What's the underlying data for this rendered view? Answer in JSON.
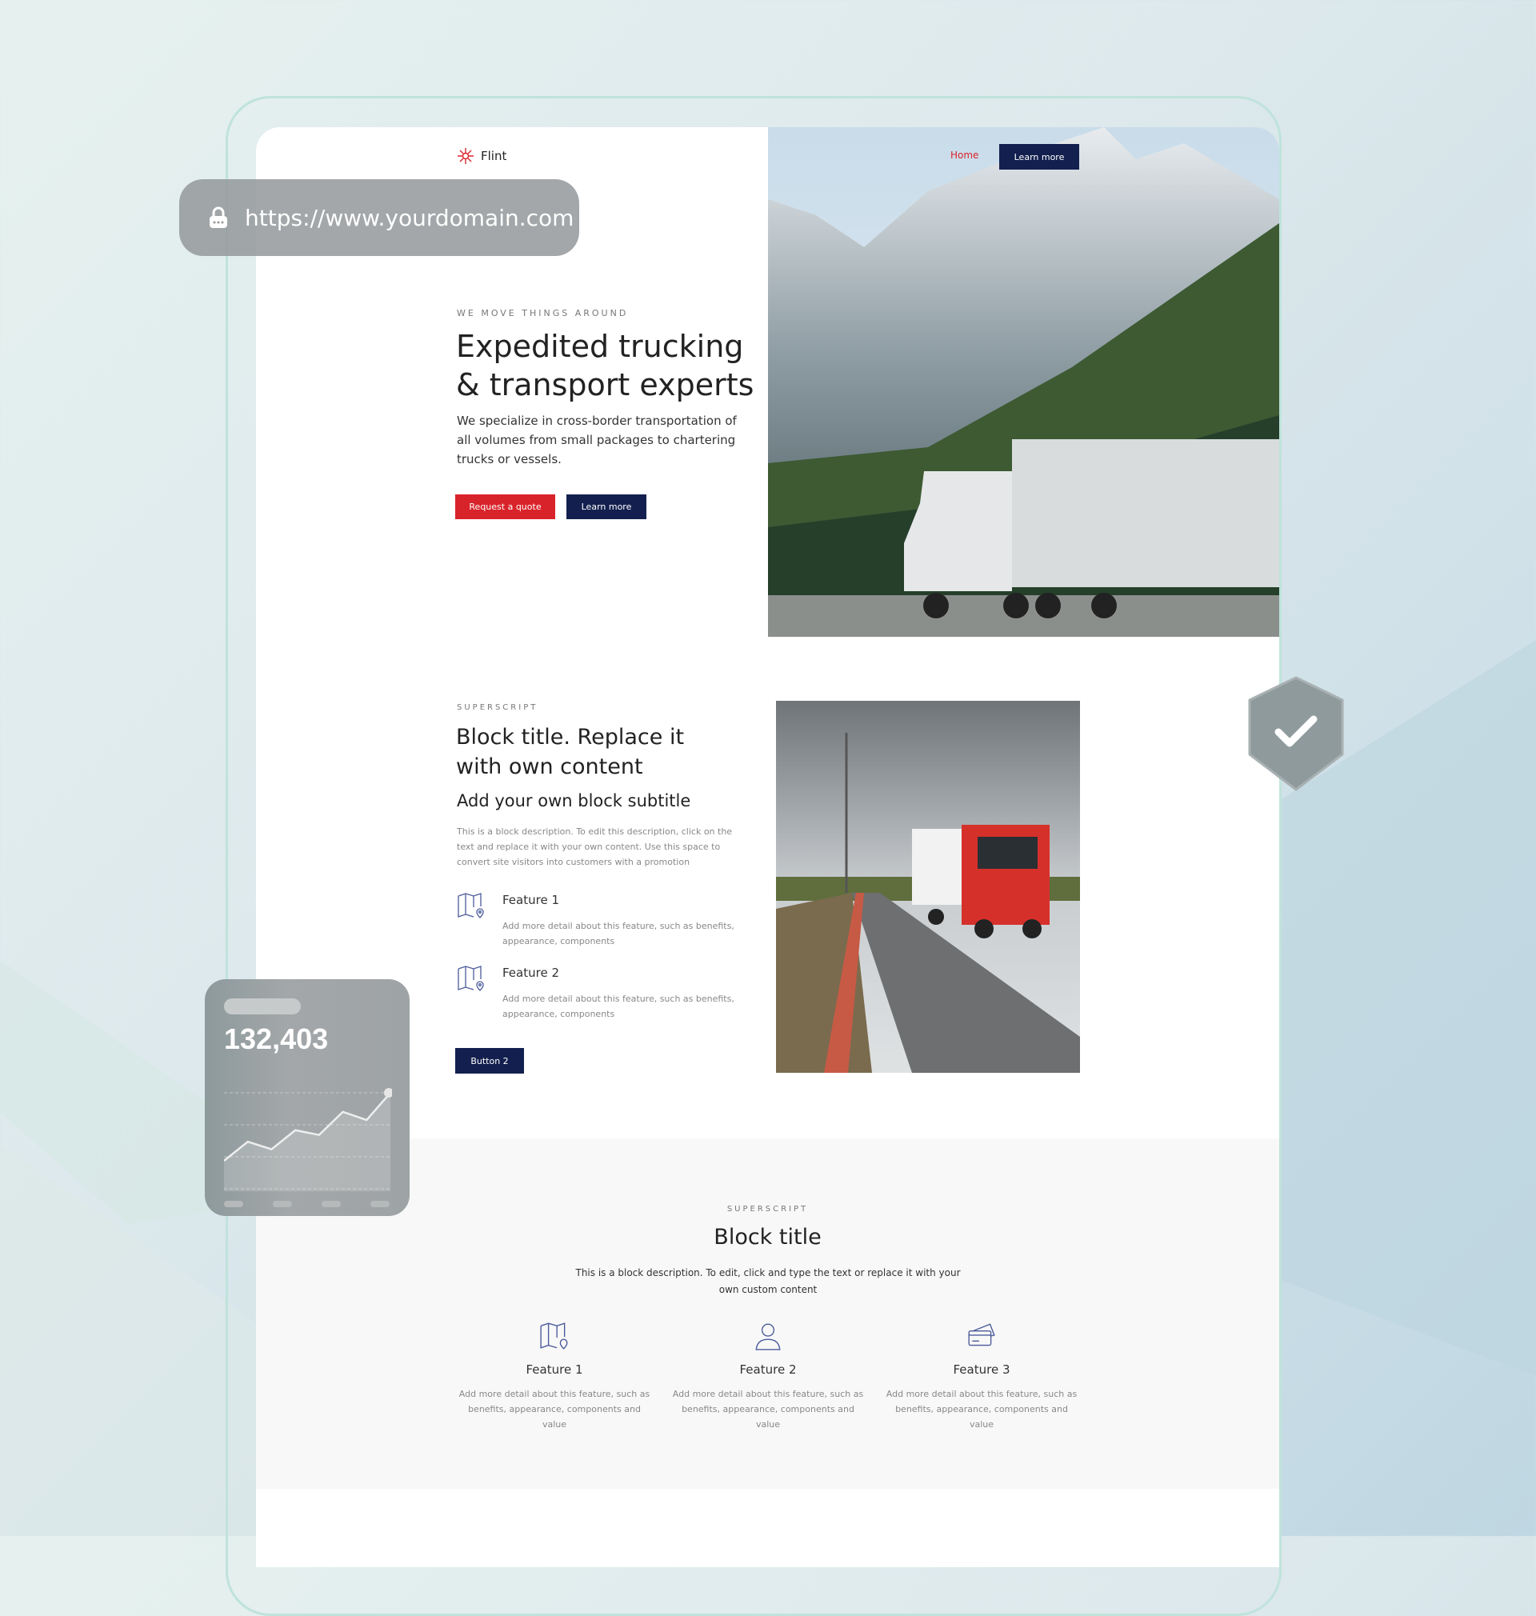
{
  "browser": {
    "url": "https://www.yourdomain.com",
    "lock_icon": "lock-icon"
  },
  "header": {
    "brand": "Flint",
    "nav_home": "Home",
    "nav_cta": "Learn more",
    "brand_color": "#d9232a",
    "navy": "#13204f"
  },
  "hero": {
    "superscript": "WE MOVE THINGS AROUND",
    "title_line1": "Expedited trucking",
    "title_line2": "& transport experts",
    "description": "We specialize in cross-border transportation of all volumes from small packages to chartering trucks or vessels.",
    "primary_button": "Request a quote",
    "secondary_button": "Learn more"
  },
  "block": {
    "superscript": "SUPERSCRIPT",
    "title": "Block title. Replace it with own content",
    "subtitle": "Add your own block subtitle",
    "description": "This is a block description. To edit this description, click on the text and replace it with your own content. Use this space to convert site visitors into customers with a promotion",
    "features": [
      {
        "label": "Feature 1",
        "detail": "Add more detail about this feature, such as benefits, appearance, components"
      },
      {
        "label": "Feature 2",
        "detail": "Add more detail about this feature, such as benefits, appearance, components"
      }
    ],
    "button": "Button 2"
  },
  "features_section": {
    "superscript": "SUPERSCRIPT",
    "title": "Block title",
    "description": "This is a block description. To edit, click and type the text or replace it with your own custom content",
    "items": [
      {
        "label": "Feature 1",
        "detail": "Add more detail about this feature, such as benefits, appearance, components and value",
        "icon": "map-pin-icon"
      },
      {
        "label": "Feature 2",
        "detail": "Add more detail about this feature, such as benefits, appearance, components and value",
        "icon": "person-icon"
      },
      {
        "label": "Feature 3",
        "detail": "Add more detail about this feature, such as benefits, appearance, components and value",
        "icon": "credit-card-icon"
      }
    ]
  },
  "stats_card": {
    "value": "132,403",
    "trend": [
      0.0,
      0.28,
      0.17,
      0.45,
      0.38,
      0.72,
      0.6,
      1.0
    ]
  },
  "badge": {
    "icon": "shield-check-icon"
  }
}
